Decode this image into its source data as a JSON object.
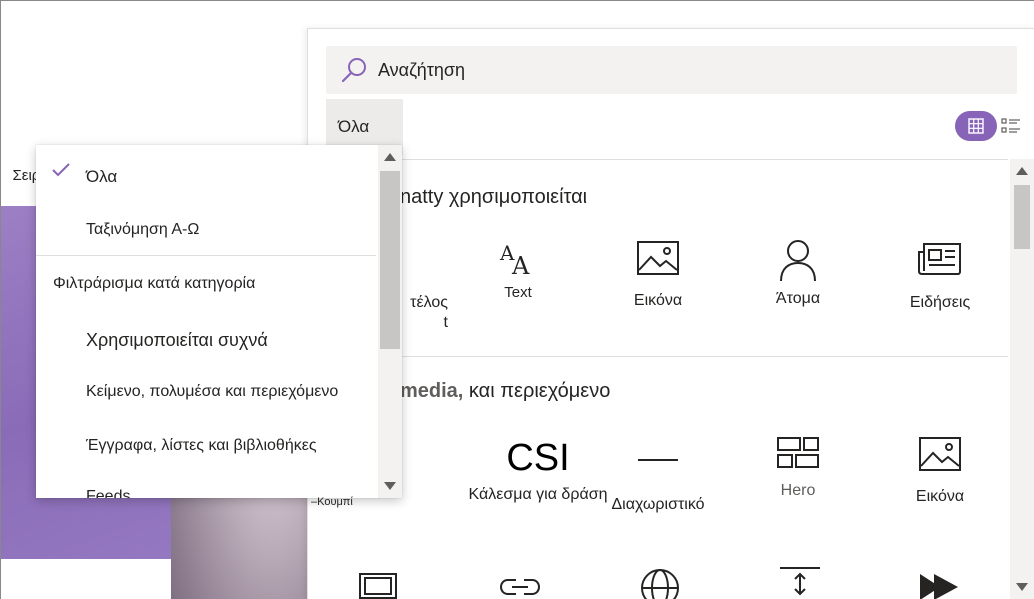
{
  "background": {
    "crumb": "Σειρά"
  },
  "search": {
    "placeholder": "Αναζήτηση"
  },
  "filter": {
    "selected_label": "Όλα"
  },
  "view_toggle": {
    "grid_icon": "grid-view-icon",
    "list_icon": "list-view-icon",
    "accent": "#8764b8"
  },
  "sections": [
    {
      "title_tail": "natty χρησιμοποιείται",
      "tiles": [
        {
          "label": "τέλος",
          "sub": "t",
          "icon": "title-icon"
        },
        {
          "label": "Text",
          "icon": "text-icon"
        },
        {
          "label": "Εικόνα",
          "icon": "image-icon"
        },
        {
          "label": "Άτομα",
          "icon": "person-icon"
        },
        {
          "label": "Ειδήσεις",
          "icon": "news-icon"
        }
      ]
    },
    {
      "title_muted": "media,",
      "title_tail": "και περιεχόμενο",
      "tiles": [
        {
          "label": "Κάλεσμα για δράση",
          "glyph": "CSI",
          "icon": "call-to-action-icon"
        },
        {
          "label": "Διαχωριστικό",
          "icon": "divider-icon"
        },
        {
          "label": "Hero",
          "icon": "hero-icon"
        },
        {
          "label": "Εικόνα",
          "icon": "image-icon"
        }
      ]
    }
  ],
  "dropdown": {
    "items": [
      {
        "label": "Όλα",
        "checked": true
      },
      {
        "label": "Ταξινόμηση Α-Ω"
      },
      {
        "label": "Φιλτράρισμα κατά κατηγορία"
      },
      {
        "label": "Χρησιμοποιείται συχνά"
      },
      {
        "label": "Κείμενο, πολυμέσα και περιεχόμενο"
      },
      {
        "label": "Έγγραφα, λίστες και βιβλιοθήκες"
      },
      {
        "label": "Feeds"
      }
    ],
    "caption": "–Κουμπί"
  }
}
